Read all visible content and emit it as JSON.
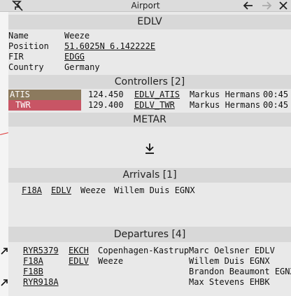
{
  "window": {
    "title": "Airport"
  },
  "icons": {
    "pin": "pin-off-icon",
    "back": "arrow-left-icon",
    "forward": "arrow-right-icon",
    "close": "close-icon",
    "download": "download-icon"
  },
  "airport": {
    "code": "EDLV",
    "fields": [
      {
        "label": "Name",
        "value": "Weeze",
        "link": false
      },
      {
        "label": "Position",
        "value": "51.6025N 6.142222E",
        "link": true
      },
      {
        "label": "FIR",
        "value": "EDGG",
        "link": true
      },
      {
        "label": "Country",
        "value": "Germany",
        "link": false
      }
    ]
  },
  "controllers": {
    "header": "Controllers [2]",
    "items": [
      {
        "type": "ATIS",
        "color": "#8c7a5e",
        "freq": "124.450",
        "callsign": "EDLV_ATIS",
        "name": "Markus Hermans",
        "time": "00:45"
      },
      {
        "type": "TWR",
        "color": "#c85565",
        "freq": "129.400",
        "callsign": "EDLV_TWR",
        "name": "Markus Hermans",
        "time": "00:45"
      }
    ]
  },
  "metar": {
    "header": "METAR"
  },
  "arrivals": {
    "header": "Arrivals [1]",
    "items": [
      {
        "aircraft": "F18A",
        "code": "EDLV",
        "city": "Weeze",
        "pilot": "Willem Duis EGNX"
      }
    ]
  },
  "departures": {
    "header": "Departures [4]",
    "items": [
      {
        "airborne": true,
        "callsign": "RYR5379",
        "code": "EKCH",
        "city": "Copenhagen-Kastrup",
        "pilot": "Marc Oelsner EDLV"
      },
      {
        "airborne": false,
        "callsign": "F18A",
        "code": "EDLV",
        "city": "Weeze",
        "pilot": "Willem Duis EGNX"
      },
      {
        "airborne": false,
        "callsign": "F18B",
        "code": "",
        "city": "",
        "pilot": "Brandon Beaumont EGNX"
      },
      {
        "airborne": true,
        "callsign": "RYR918A",
        "code": "",
        "city": "",
        "pilot": "Max Stevens EHBK"
      }
    ]
  }
}
